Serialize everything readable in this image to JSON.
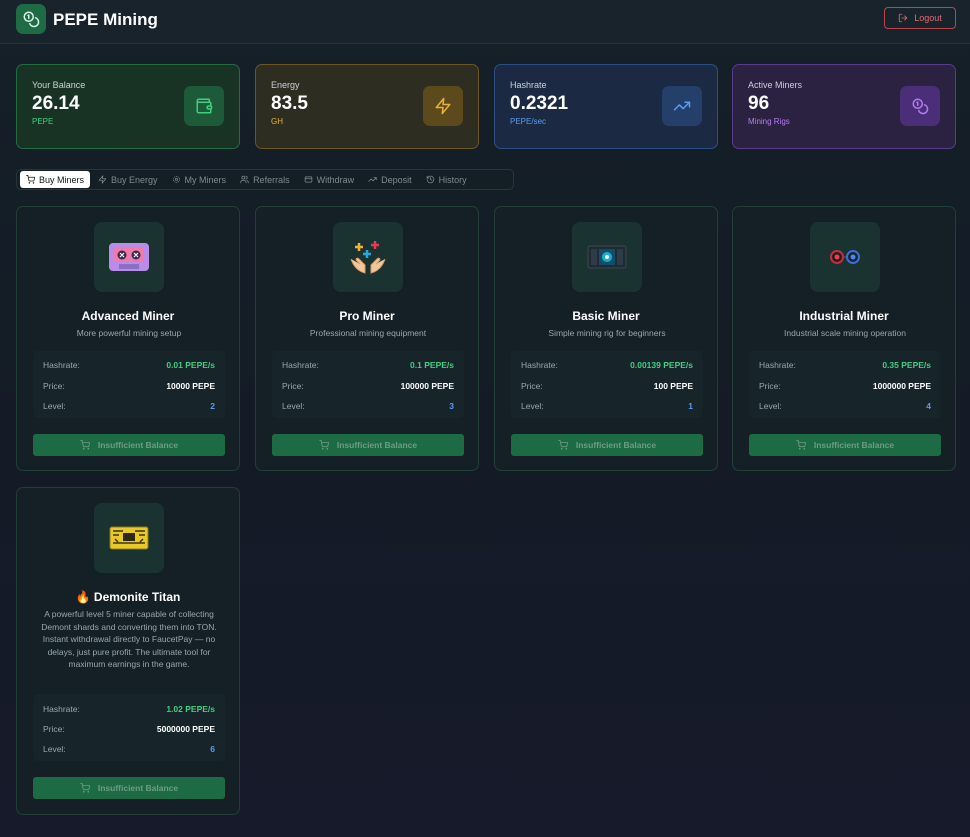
{
  "header": {
    "app_title": "PEPE Mining",
    "logout_label": "Logout"
  },
  "stats": [
    {
      "label": "Your Balance",
      "value": "26.14",
      "unit": "PEPE",
      "icon": "wallet-icon",
      "accent": "#3fd07f"
    },
    {
      "label": "Energy",
      "value": "83.5",
      "unit": "GH",
      "icon": "lightning-icon",
      "accent": "#e8b13a"
    },
    {
      "label": "Hashrate",
      "value": "0.2321",
      "unit": "PEPE/sec",
      "icon": "trending-up-icon",
      "accent": "#5b9bf0"
    },
    {
      "label": "Active Miners",
      "value": "96",
      "unit": "Mining Rigs",
      "icon": "coins-icon",
      "accent": "#b57cf2"
    }
  ],
  "tabs": [
    {
      "label": "Buy Miners",
      "icon": "cart-icon",
      "active": true
    },
    {
      "label": "Buy Energy",
      "icon": "lightning-icon",
      "active": false
    },
    {
      "label": "My Miners",
      "icon": "cog-icon",
      "active": false
    },
    {
      "label": "Referrals",
      "icon": "users-icon",
      "active": false
    },
    {
      "label": "Withdraw",
      "icon": "wallet-icon",
      "active": false
    },
    {
      "label": "Deposit",
      "icon": "trending-up-icon",
      "active": false
    },
    {
      "label": "History",
      "icon": "history-icon",
      "active": false
    }
  ],
  "row_labels": {
    "hashrate": "Hashrate:",
    "price": "Price:",
    "level": "Level:"
  },
  "miners": [
    {
      "name": "Advanced Miner",
      "description": "More powerful mining setup",
      "hashrate": "0.01 PEPE/s",
      "price": "10000 PEPE",
      "level": "2",
      "button": "Insufficient Balance",
      "image": "cassette-icon"
    },
    {
      "name": "Pro Miner",
      "description": "Professional mining equipment",
      "hashrate": "0.1 PEPE/s",
      "price": "100000 PEPE",
      "level": "3",
      "button": "Insufficient Balance",
      "image": "hands-plus-icon"
    },
    {
      "name": "Basic Miner",
      "description": "Simple mining rig for beginners",
      "hashrate": "0.00139 PEPE/s",
      "price": "100 PEPE",
      "level": "1",
      "button": "Insufficient Balance",
      "image": "gpu-rig-icon"
    },
    {
      "name": "Industrial Miner",
      "description": "Industrial scale mining operation",
      "hashrate": "0.35 PEPE/s",
      "price": "1000000 PEPE",
      "level": "4",
      "button": "Insufficient Balance",
      "image": "goggles-icon"
    },
    {
      "name": "🔥 Demonite Titan",
      "description": "A powerful level 5 miner capable of collecting Demont shards and converting them into TON. Instant withdrawal directly to FaucetPay — no delays, just pure profit. The ultimate tool for maximum earnings in the game.",
      "hashrate": "1.02 PEPE/s",
      "price": "5000000 PEPE",
      "level": "6",
      "button": "Insufficient Balance",
      "image": "titan-board-icon"
    }
  ]
}
